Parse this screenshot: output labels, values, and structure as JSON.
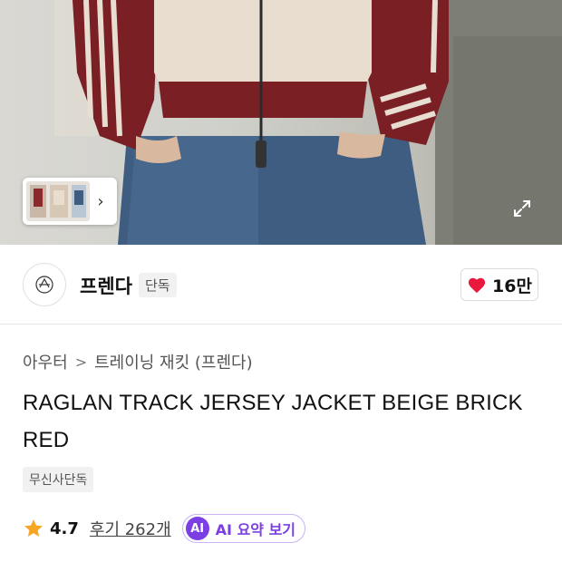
{
  "hero": {
    "image_alt": "model wearing raglan track jersey jacket",
    "icons": {
      "expand": "expand-icon",
      "next": "chevron-right-icon"
    }
  },
  "brand": {
    "name": "프렌다",
    "exclusive_badge": "단독",
    "like_count": "16만",
    "logo_icon": "brand-logo",
    "heart_icon": "heart-icon",
    "heart_color": "#e8193c"
  },
  "breadcrumb": {
    "category": "아우터",
    "separator": ">",
    "subcategory": "트레이닝 재킷 (프렌다)"
  },
  "product": {
    "title": "RAGLAN TRACK JERSEY JACKET BEIGE BRICK RED",
    "tag": "무신사단독"
  },
  "rating": {
    "star_icon": "star-icon",
    "star_color": "#f5a623",
    "score": "4.7",
    "reviews_label": "후기 262개",
    "ai_badge": "AI",
    "ai_label": "AI 요약 보기",
    "ai_color": "#7b3fe4"
  }
}
